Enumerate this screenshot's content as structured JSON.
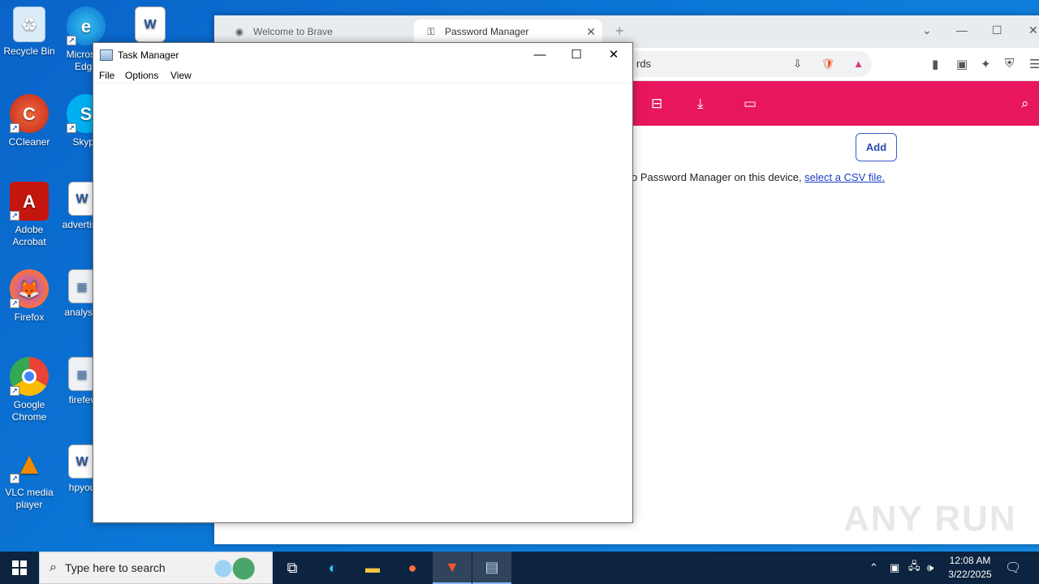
{
  "desktop": {
    "icons": [
      {
        "label": "Recycle Bin",
        "icon": "recycle-bin-icon",
        "color": "#cfe6f7"
      },
      {
        "label": "Microsoft Edge",
        "icon": "edge-icon",
        "color": "#1a8fd8"
      },
      {
        "label": "CCleaner",
        "icon": "ccleaner-icon",
        "color": "#d43b2a"
      },
      {
        "label": "Skype",
        "icon": "skype-icon",
        "color": "#00aff0"
      },
      {
        "label": "Adobe Acrobat",
        "icon": "acrobat-icon",
        "color": "#c4160e"
      },
      {
        "label": "advertise",
        "icon": "word-doc-icon",
        "color": "#2b5797"
      },
      {
        "label": "Firefox",
        "icon": "firefox-icon",
        "color": "#ff7139"
      },
      {
        "label": "analysis",
        "icon": "image-file-icon",
        "color": "#e8eef5"
      },
      {
        "label": "Google Chrome",
        "icon": "chrome-icon",
        "color": "#4285f4"
      },
      {
        "label": "firefev",
        "icon": "image-file-icon",
        "color": "#e8eef5"
      },
      {
        "label": "VLC media player",
        "icon": "vlc-icon",
        "color": "#f08a00"
      },
      {
        "label": "hpyou",
        "icon": "word-doc-icon",
        "color": "#2b5797"
      },
      {
        "label": "",
        "icon": "word-doc-icon",
        "color": "#2b5797"
      }
    ]
  },
  "browser": {
    "tabs": [
      {
        "label": "Welcome to Brave",
        "active": false
      },
      {
        "label": "Password Manager",
        "active": true
      }
    ],
    "url_text": "rds",
    "header_color": "#e8165e",
    "add_button": "Add",
    "import_text": "o Password Manager on this device, ",
    "import_link": "select a CSV file."
  },
  "task_manager": {
    "title": "Task Manager",
    "menu": [
      "File",
      "Options",
      "View"
    ]
  },
  "taskbar": {
    "search_placeholder": "Type here to search",
    "time": "12:08 AM",
    "date": "3/22/2025"
  },
  "watermark": "ANY RUN"
}
